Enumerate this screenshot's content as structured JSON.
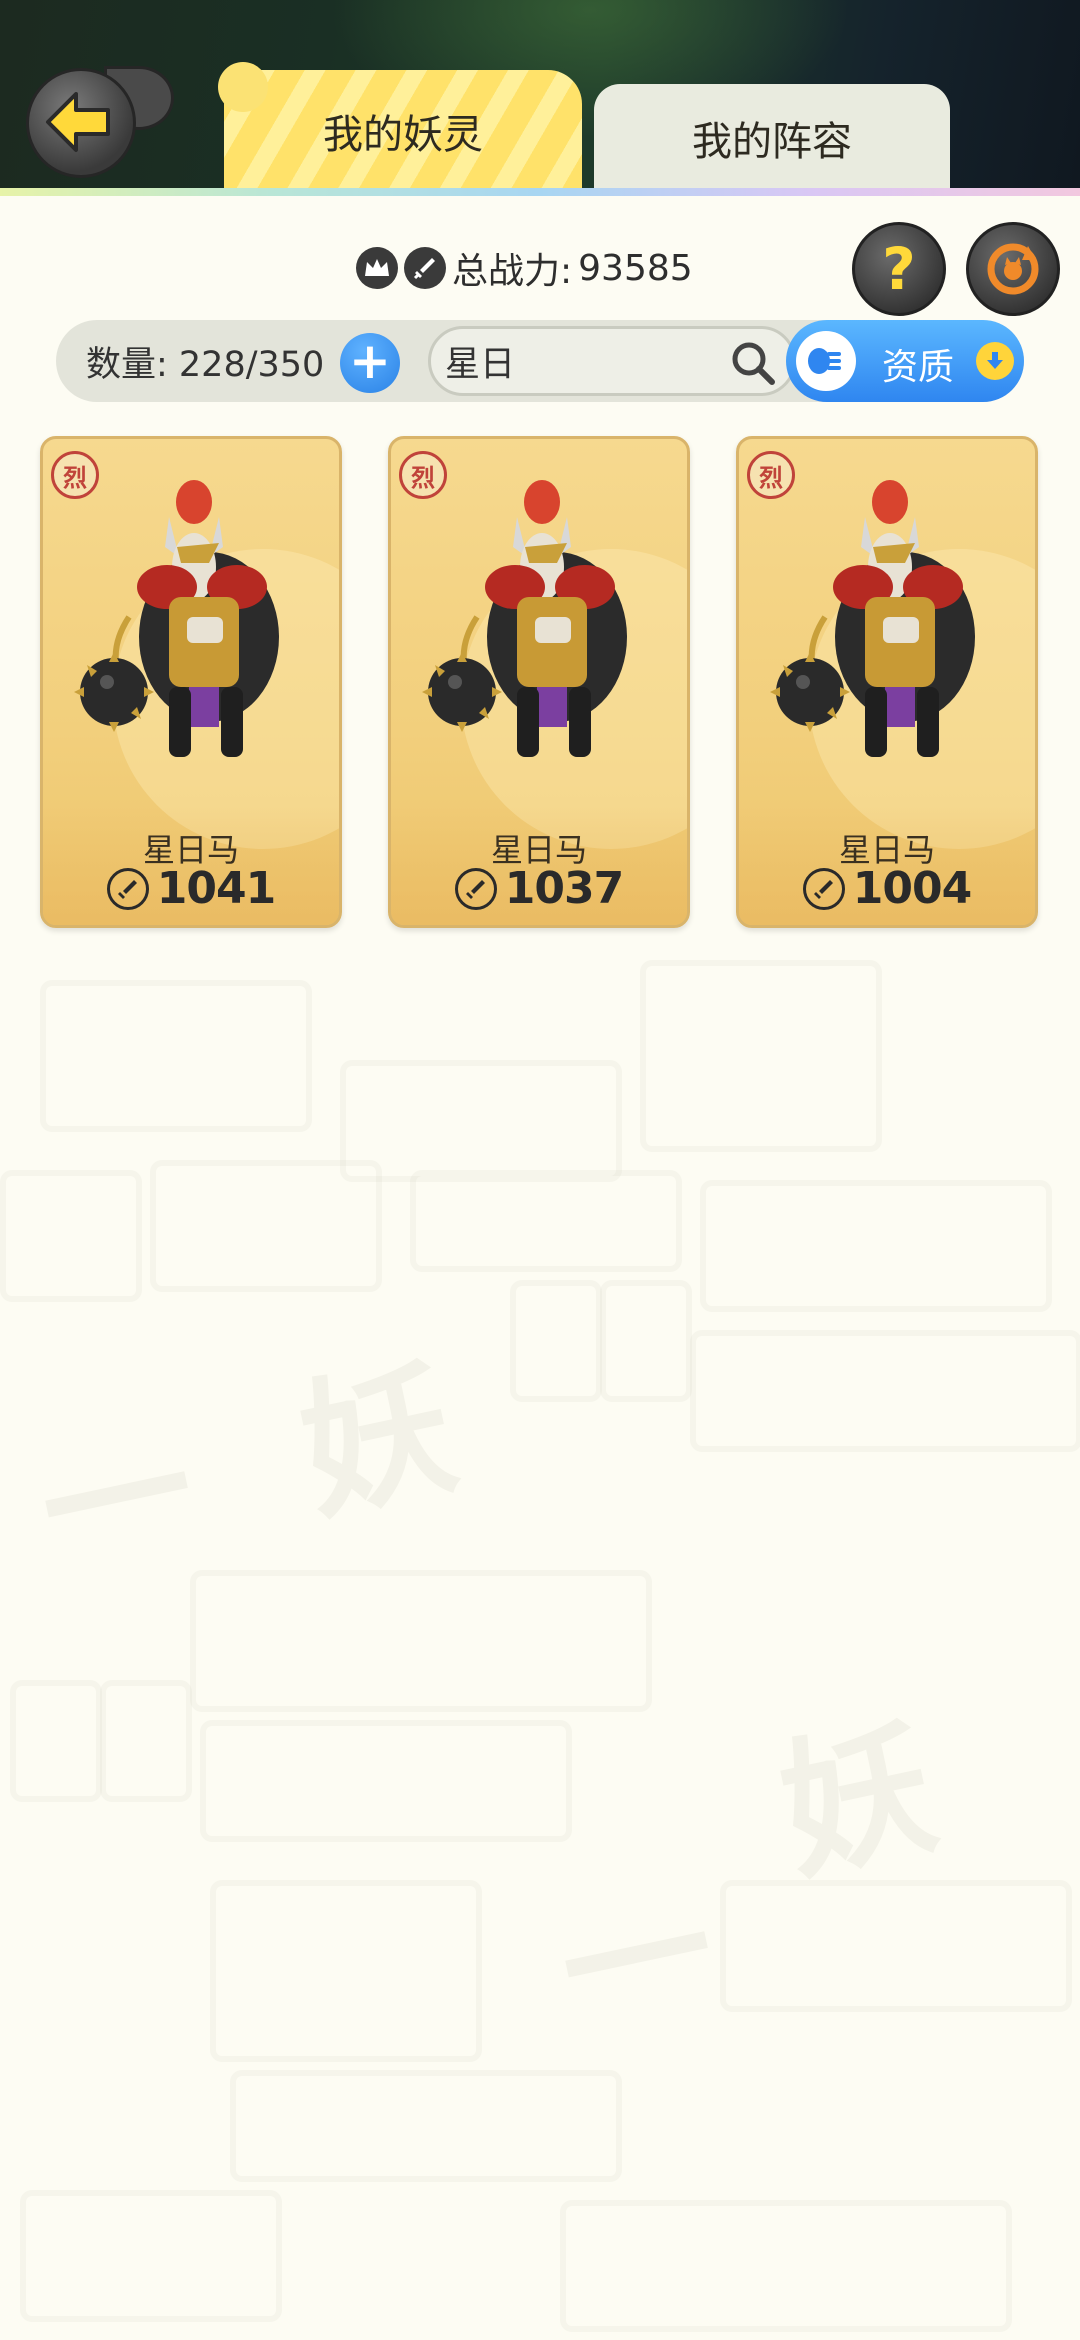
{
  "tabs": [
    {
      "label": "我的妖灵",
      "active": true
    },
    {
      "label": "我的阵容",
      "active": false
    }
  ],
  "power": {
    "label": "总战力:",
    "value": "93585"
  },
  "inventory": {
    "count_label": "数量: 228/350"
  },
  "search": {
    "value": "星日"
  },
  "sort": {
    "label": "资质"
  },
  "cards": [
    {
      "element": "烈",
      "name": "星日马",
      "power": "1041"
    },
    {
      "element": "烈",
      "name": "星日马",
      "power": "1037"
    },
    {
      "element": "烈",
      "name": "星日马",
      "power": "1004"
    }
  ],
  "colors": {
    "accent_blue": "#2f86f0",
    "tab_yellow": "#ffe26a",
    "card_gold": "#f2cf7c",
    "element_red": "#c0433a",
    "help_yellow": "#ffd93a",
    "refresh_orange": "#f08a2a"
  },
  "icons": {
    "back": "back-arrow-icon",
    "crown": "crown-icon",
    "sword": "sword-icon",
    "help": "question-icon",
    "refresh": "refresh-icon",
    "add": "plus-icon",
    "search": "magnifier-icon",
    "sort": "sort-list-icon",
    "sort_direction": "arrow-down-icon"
  }
}
